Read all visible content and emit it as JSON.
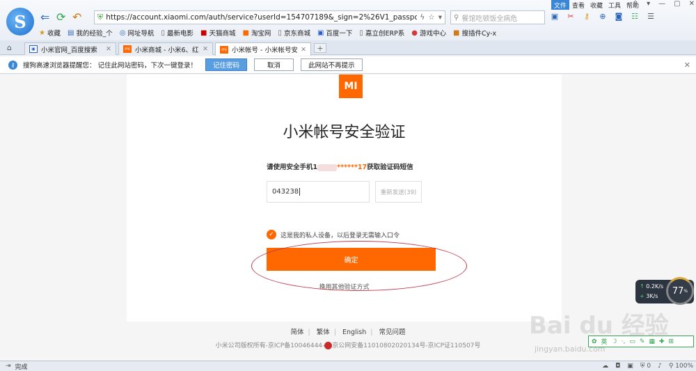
{
  "menu": {
    "items": [
      "文件",
      "查看",
      "收藏",
      "工具",
      "帮助"
    ]
  },
  "toolbar": {
    "logo_letter": "S",
    "url": "https://account.xiaomi.com/auth/service?userId=154707189&_sign=2%26V1_passport%2",
    "search_placeholder": "餐馆吃顿饭全病危"
  },
  "bookmarks": [
    {
      "icon": "star-icon",
      "label": "收藏"
    },
    {
      "icon": "page-icon",
      "label": "我的经验_个"
    },
    {
      "icon": "globe-icon",
      "label": "网址导航"
    },
    {
      "icon": "page-icon",
      "label": "最新电影"
    },
    {
      "icon": "tmall-icon",
      "label": "天猫商城"
    },
    {
      "icon": "taobao-icon",
      "label": "淘宝网"
    },
    {
      "icon": "page-icon",
      "label": "京东商城"
    },
    {
      "icon": "baidu-icon",
      "label": "百度一下"
    },
    {
      "icon": "page-icon",
      "label": "嘉立创ERP系"
    },
    {
      "icon": "game-icon",
      "label": "游戏中心"
    },
    {
      "icon": "plugin-icon",
      "label": "搜插件Cy-x"
    }
  ],
  "tabs": [
    {
      "label": "小米官网_百度搜索"
    },
    {
      "label": "小米商城 - 小米6、红米"
    },
    {
      "label": "小米帐号 - 小米帐号安全"
    }
  ],
  "pwbar": {
    "message": "搜狗高速浏览器提醒您： 记住此网站密码，下次一键登录！",
    "remember": "记住密码",
    "cancel": "取消",
    "never": "此网站不再提示"
  },
  "page": {
    "logo": "MI",
    "heading": "小米帐号安全验证",
    "prompt_prefix": "请使用安全手机1",
    "prompt_masked": "******17",
    "prompt_suffix": "获取验证码短信",
    "code_value": "043238",
    "resend": "重新发送(39)",
    "private_device": "这是我的私人设备，以后登录无需输入口令",
    "confirm": "确定",
    "other_method": "换用其他验证方式"
  },
  "footer": {
    "links": [
      "简体",
      "繁体",
      "English",
      "常见问题"
    ],
    "copyright_a": "小米公司版权所有-京ICP备10046444-",
    "copyright_b": "京公网安备11010802020134号-京ICP证110507号"
  },
  "speed": {
    "up": "0.2",
    "up_unit": "K/s",
    "down": "3",
    "down_unit": "K/s",
    "percent": "77",
    "percent_sign": "%"
  },
  "watermark": {
    "brand": "Bai du 经验",
    "url": "jingyan.baidu.com"
  },
  "statusbar": {
    "text": "完成",
    "zoom": "100%",
    "count": "0"
  }
}
